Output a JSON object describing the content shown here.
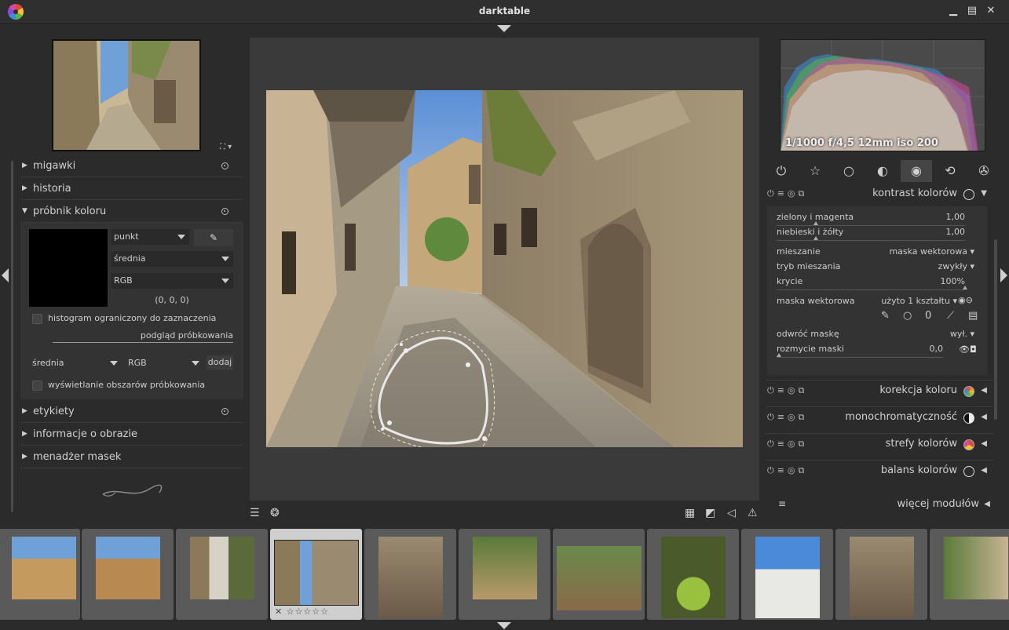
{
  "window": {
    "title": "darktable"
  },
  "left": {
    "sections": [
      {
        "label": "migawki"
      },
      {
        "label": "historia"
      },
      {
        "label": "próbnik koloru"
      },
      {
        "label": "etykiety"
      },
      {
        "label": "informacje o obrazie"
      },
      {
        "label": "menadżer masek"
      }
    ],
    "picker": {
      "mode": "punkt",
      "stat": "średnia",
      "colorspace": "RGB",
      "value": "(0, 0, 0)",
      "restrict_label": "histogram ograniczony do zaznaczenia",
      "preview_label": "podgląd próbkowania",
      "sample_stat": "średnia",
      "sample_space": "RGB",
      "add_label": "dodaj",
      "display_label": "wyświetlanie obszarów próbkowania"
    }
  },
  "right": {
    "histogram_info": "1/1000 f/4,5 12mm iso 200",
    "module": {
      "name": "kontrast kolorów",
      "rows": {
        "green_magenta": {
          "label": "zielony i magenta",
          "value": "1,00"
        },
        "blue_yellow": {
          "label": "niebieski i żółty",
          "value": "1,00"
        },
        "blend": {
          "label": "mieszanie",
          "value": "maska wektorowa"
        },
        "blend_mode": {
          "label": "tryb mieszania",
          "value": "zwykły"
        },
        "opacity": {
          "label": "krycie",
          "value": "100%"
        },
        "vector_mask": {
          "label": "maska wektorowa",
          "value": "użyto 1 kształtu"
        },
        "invert": {
          "label": "odwróć maskę",
          "value": "wył."
        },
        "blur": {
          "label": "rozmycie maski",
          "value": "0,0"
        }
      }
    },
    "modules": [
      {
        "name": "korekcja koloru"
      },
      {
        "name": "monochromatyczność"
      },
      {
        "name": "strefy kolorów"
      },
      {
        "name": "balans kolorów"
      }
    ],
    "more_modules": "więcej modułów"
  }
}
